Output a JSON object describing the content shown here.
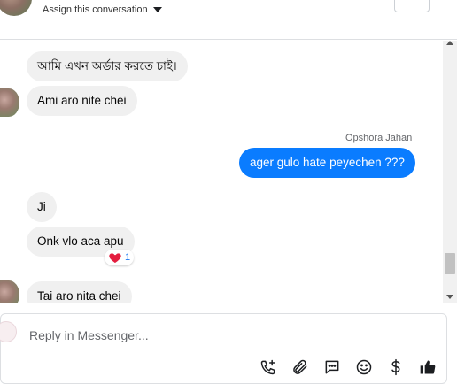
{
  "header": {
    "assign_label": "Assign this conversation"
  },
  "messages": [
    {
      "direction": "incoming",
      "text": "আমি এখন অর্ডার করতে চাই।"
    },
    {
      "direction": "incoming",
      "text": "Ami aro nite chei"
    },
    {
      "direction": "outgoing",
      "sender": "Opshora Jahan",
      "text": "ager gulo hate peyechen ???"
    },
    {
      "direction": "incoming",
      "text": "Ji"
    },
    {
      "direction": "incoming",
      "text": "Onk vlo aca apu",
      "reaction": {
        "emoji": "heart",
        "count": "1"
      }
    },
    {
      "direction": "incoming",
      "text": "Tai aro nita chei"
    }
  ],
  "composer": {
    "placeholder": "Reply in Messenger...",
    "tools": [
      "call-add-icon",
      "attachment-icon",
      "saved-replies-icon",
      "emoji-icon",
      "payment-icon",
      "like-icon"
    ]
  },
  "colors": {
    "outgoing_bubble": "#0a7cff",
    "incoming_bubble": "#f0f0f0",
    "icon": "#1c1e21"
  }
}
